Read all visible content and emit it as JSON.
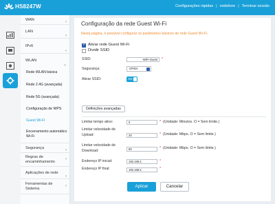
{
  "header": {
    "brand": "HS8247W",
    "quick_settings": "Configurações rápidas",
    "user": "vodafone",
    "logout": "Terminar sessão",
    "accent": "#1aa0d8"
  },
  "icons": [
    "status-icon",
    "lan-icon",
    "services-icon",
    "voip-icon",
    "advanced-settings-icon"
  ],
  "menu": {
    "wan": "WAN",
    "lan": "LAN",
    "ipv6": "IPv6",
    "wlan": "WLAN",
    "wlan_items": {
      "basic": "Rede WLAN básica",
      "n24": "Rede 2.4G (avançada)",
      "n5": "Rede 5G (avançada)",
      "wps": "Configuração de WPS",
      "guest": "Guest Wi-Fi",
      "auto_off_1": "Encerramento automático",
      "auto_off_2": "Wi-Fi"
    },
    "security": "Segurança",
    "forwarding_1": "Regras de",
    "forwarding_2": "encaminhamento",
    "apps": "Aplicações de rede",
    "tools_1": "Ferramentas de",
    "tools_2": "Sistema"
  },
  "page": {
    "title": "Configuração da rede Guest Wi-Fi",
    "notice": "Nesta página, é possível configurar os parâmetros básicos de rede Guest Wi-Fi.",
    "enable_guest": "Ativar rede Guest Wi-Fi",
    "split_ssid": "Dividir SSID",
    "ssid_label": "SSID:",
    "ssid_value": "-WiFi-Guest",
    "security_label": "Segurança:",
    "security_value": "OPEN",
    "enable_ssid_label": "Ativar SSID:",
    "enable_ssid_value": "ON",
    "advanced_button": "Definições avançadas",
    "time_limit_label": "Limitar tempo ativo:",
    "time_limit_value": "0",
    "time_limit_hint": "(Unidade: Minutos. O = Sem limite.)",
    "upload_label_1": "Limitar velocidade de",
    "upload_label_2": "Upload:",
    "upload_value": "20",
    "upload_hint": "(Unidade: Mbps. O = Sem limite.)",
    "download_label_1": "Limitar velocidade de",
    "download_label_2": "Download:",
    "download_value": "50",
    "download_hint": "(Unidade: Mbps. O = Sem limite.)",
    "ip_start_label": "Endereço IP inicial:",
    "ip_start_value": "192.168.2.",
    "ip_end_label": "Endereço IP final:",
    "ip_end_value": "192.168.2.",
    "apply": "Aplicar",
    "cancel": "Cancelar"
  }
}
